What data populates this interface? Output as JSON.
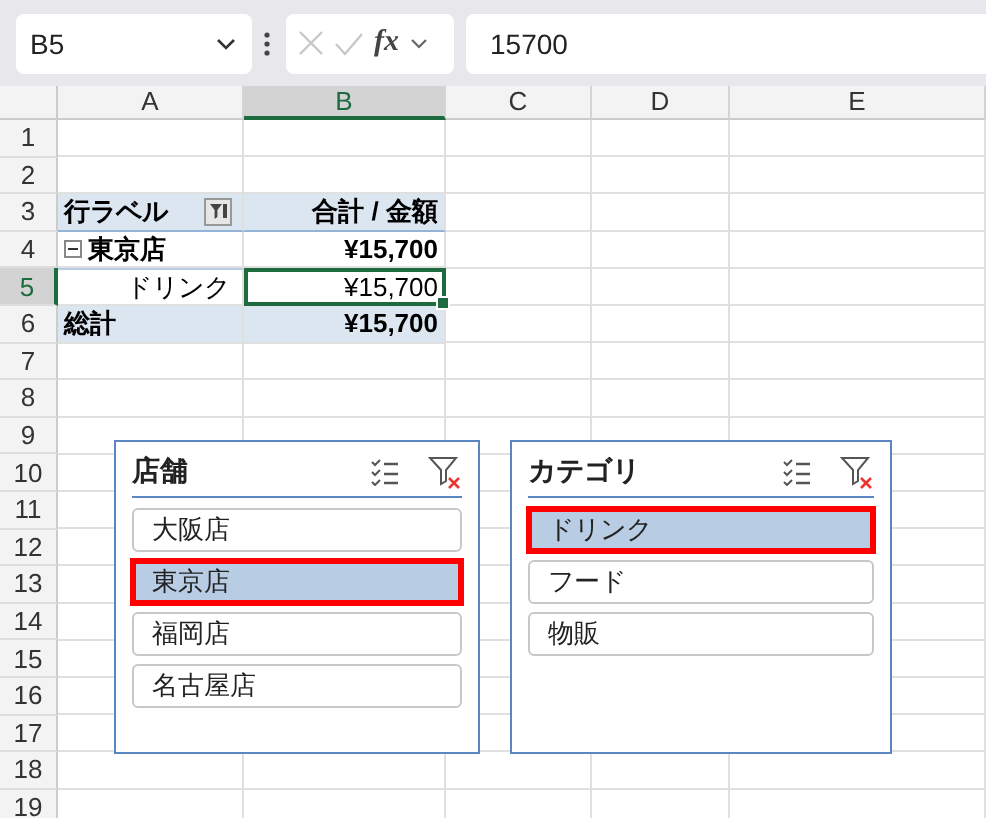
{
  "name_box": {
    "value": "B5"
  },
  "formula_bar": {
    "function_label": "fx",
    "value": "15700"
  },
  "columns": [
    {
      "label": "A",
      "selected": false
    },
    {
      "label": "B",
      "selected": true
    },
    {
      "label": "C",
      "selected": false
    },
    {
      "label": "D",
      "selected": false
    },
    {
      "label": "E",
      "selected": false
    }
  ],
  "rows": [
    {
      "label": "1",
      "selected": false,
      "kind": "blank"
    },
    {
      "label": "2",
      "selected": false,
      "kind": "blank"
    },
    {
      "label": "3",
      "selected": false,
      "kind": "pivot-header",
      "cells": [
        {
          "text": "行ラベル",
          "selected": false
        },
        {
          "text": "合計 / 金額",
          "selected": false
        }
      ]
    },
    {
      "label": "4",
      "selected": false,
      "kind": "pivot-group",
      "expanded": true,
      "cells": [
        {
          "text": "東京店",
          "selected": false
        },
        {
          "text": "¥15,700",
          "selected": false
        }
      ]
    },
    {
      "label": "5",
      "selected": true,
      "kind": "pivot-item",
      "cells": [
        {
          "text": "ドリンク",
          "selected": false
        },
        {
          "text": "¥15,700",
          "selected": true
        }
      ]
    },
    {
      "label": "6",
      "selected": false,
      "kind": "pivot-total",
      "cells": [
        {
          "text": "総計",
          "selected": false
        },
        {
          "text": "¥15,700",
          "selected": false
        }
      ]
    },
    {
      "label": "7",
      "selected": false,
      "kind": "blank"
    },
    {
      "label": "8",
      "selected": false,
      "kind": "blank"
    },
    {
      "label": "9",
      "selected": false,
      "kind": "blank"
    },
    {
      "label": "10",
      "selected": false,
      "kind": "blank"
    },
    {
      "label": "11",
      "selected": false,
      "kind": "blank"
    },
    {
      "label": "12",
      "selected": false,
      "kind": "blank"
    },
    {
      "label": "13",
      "selected": false,
      "kind": "blank"
    },
    {
      "label": "14",
      "selected": false,
      "kind": "blank"
    },
    {
      "label": "15",
      "selected": false,
      "kind": "blank"
    },
    {
      "label": "16",
      "selected": false,
      "kind": "blank"
    },
    {
      "label": "17",
      "selected": false,
      "kind": "blank"
    },
    {
      "label": "18",
      "selected": false,
      "kind": "blank"
    },
    {
      "label": "19",
      "selected": false,
      "kind": "blank"
    }
  ],
  "slicers": [
    {
      "title": "店舗",
      "items": [
        {
          "label": "大阪店",
          "selected": false,
          "highlighted": false
        },
        {
          "label": "東京店",
          "selected": true,
          "highlighted": true
        },
        {
          "label": "福岡店",
          "selected": false,
          "highlighted": false
        },
        {
          "label": "名古屋店",
          "selected": false,
          "highlighted": false
        }
      ]
    },
    {
      "title": "カテゴリ",
      "items": [
        {
          "label": "ドリンク",
          "selected": true,
          "highlighted": true
        },
        {
          "label": "フード",
          "selected": false,
          "highlighted": false
        },
        {
          "label": "物販",
          "selected": false,
          "highlighted": false
        }
      ]
    }
  ]
}
